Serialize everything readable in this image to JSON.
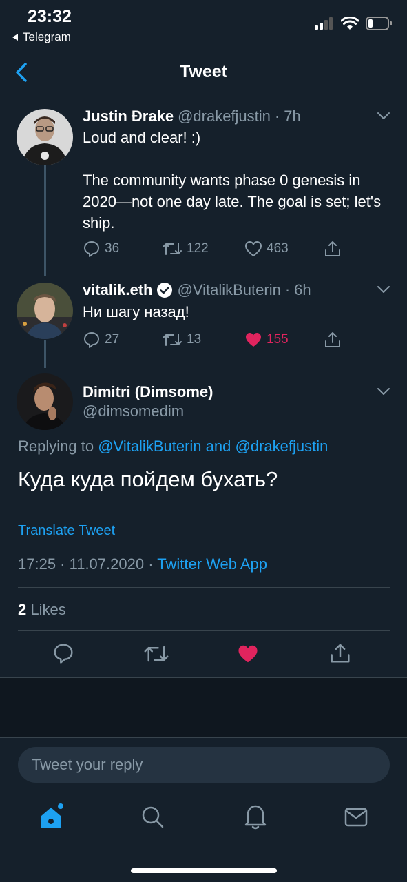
{
  "status": {
    "time": "23:32",
    "back_app": "Telegram"
  },
  "nav": {
    "title": "Tweet"
  },
  "tweets": [
    {
      "name": "Justin Ðrake",
      "handle": "@drakefjustin",
      "time": "7h",
      "text": "Loud and clear! :)\n\nThe community wants phase 0 genesis in 2020—not one day late. The goal is set; let's ship.",
      "replies": "36",
      "retweets": "122",
      "likes": "463"
    },
    {
      "name": "vitalik.eth",
      "handle": "@VitalikButerin",
      "time": "6h",
      "text": "Ни шагу назад!",
      "replies": "27",
      "retweets": "13",
      "likes": "155"
    }
  ],
  "main_tweet": {
    "name": "Dimitri (Dimsome)",
    "handle": "@dimsomedim",
    "replying_prefix": "Replying to",
    "reply_to_1": "@VitalikButerin",
    "reply_and": "and",
    "reply_to_2": "@drakefjustin",
    "text": "Куда куда пойдем бухать?",
    "translate_label": "Translate Tweet",
    "timestamp": "17:25 · 11.07.2020 ·",
    "source": "Twitter Web App",
    "likes_count": "2",
    "likes_label": "Likes"
  },
  "reply_box": {
    "placeholder": "Tweet your reply"
  },
  "colors": {
    "background": "#15202b",
    "accent": "#1da1f2",
    "like": "#e0245e",
    "muted": "#8899a6"
  },
  "icons": [
    "chevron-left-icon",
    "reply-icon",
    "retweet-icon",
    "heart-icon",
    "share-icon",
    "verified-icon",
    "home-icon",
    "search-icon",
    "bell-icon",
    "mail-icon"
  ]
}
